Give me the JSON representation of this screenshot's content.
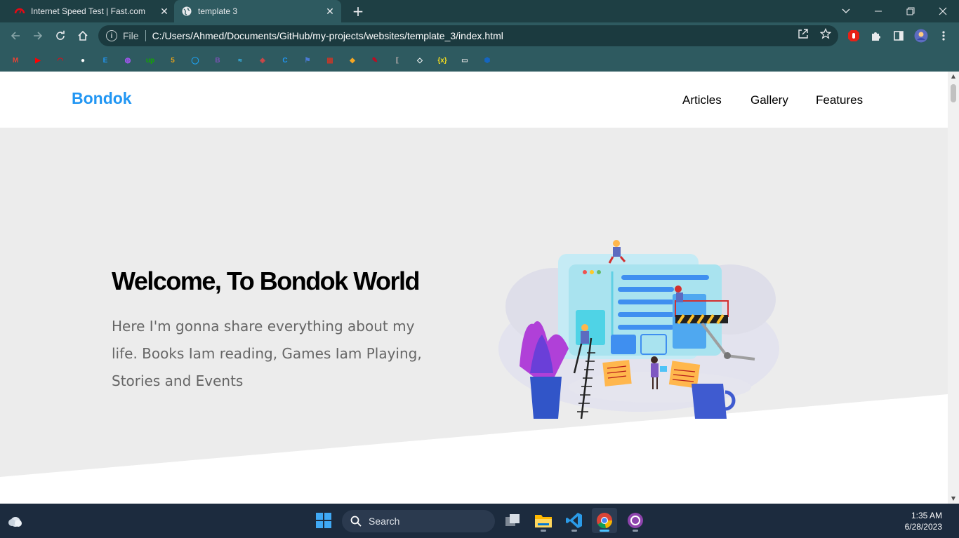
{
  "browser": {
    "tabs": [
      {
        "title": "Internet Speed Test | Fast.com",
        "active": false,
        "favicon": "fast-gauge-icon"
      },
      {
        "title": "template 3",
        "active": true,
        "favicon": "globe-icon"
      }
    ],
    "new_tab_label": "+",
    "address": {
      "scheme_label": "File",
      "url": "C:/Users/Ahmed/Documents/GitHub/my-projects/websites/template_3/index.html"
    },
    "bookmarks": [
      {
        "icon": "gmail-icon",
        "glyph": "M",
        "color": "#ea4335"
      },
      {
        "icon": "youtube-icon",
        "glyph": "▶",
        "color": "#ff0000"
      },
      {
        "icon": "fast-icon",
        "glyph": "◠",
        "color": "#e50914"
      },
      {
        "icon": "github-icon",
        "glyph": "●",
        "color": "#ffffff"
      },
      {
        "icon": "elzero-icon",
        "glyph": "E",
        "color": "#2196f3"
      },
      {
        "icon": "chat-icon",
        "glyph": "◍",
        "color": "#a855f7"
      },
      {
        "icon": "upwork-icon",
        "glyph": "up",
        "color": "#14a800"
      },
      {
        "icon": "html5-icon",
        "glyph": "5",
        "color": "#e4a11b"
      },
      {
        "icon": "circle-icon",
        "glyph": "◯",
        "color": "#1da1f2"
      },
      {
        "icon": "bootstrap-icon",
        "glyph": "B",
        "color": "#7952b3"
      },
      {
        "icon": "tailwind-icon",
        "glyph": "≈",
        "color": "#38bdf8"
      },
      {
        "icon": "gulp-icon",
        "glyph": "◈",
        "color": "#cf4647"
      },
      {
        "icon": "c-icon",
        "glyph": "C",
        "color": "#2196f3"
      },
      {
        "icon": "flag-icon",
        "glyph": "⚑",
        "color": "#4a7bd6"
      },
      {
        "icon": "grid-icon",
        "glyph": "▦",
        "color": "#c0392b"
      },
      {
        "icon": "diamond-icon",
        "glyph": "◆",
        "color": "#f5a623"
      },
      {
        "icon": "sketch-icon",
        "glyph": "✎",
        "color": "#d0021b"
      },
      {
        "icon": "brackets-icon",
        "glyph": "⟦",
        "color": "#9e9e9e"
      },
      {
        "icon": "codepen-icon",
        "glyph": "◇",
        "color": "#ffffff"
      },
      {
        "icon": "variable-icon",
        "glyph": "{x}",
        "color": "#f7df1e"
      },
      {
        "icon": "document-icon",
        "glyph": "▭",
        "color": "#e0e0e0"
      },
      {
        "icon": "shield-icon",
        "glyph": "⬢",
        "color": "#1565c0"
      }
    ]
  },
  "site": {
    "logo": "Bondok",
    "nav": [
      "Articles",
      "Gallery",
      "Features"
    ],
    "hero": {
      "title": "Welcome, To Bondok World",
      "text": "Here I'm gonna share everything about my life. Books Iam reading, Games Iam Playing, Stories and Events"
    },
    "colors": {
      "accent": "#2196f3",
      "hero_bg": "#ececec"
    }
  },
  "taskbar": {
    "search_label": "Search",
    "time": "1:35 AM",
    "date": "6/28/2023",
    "apps": [
      "task-view-icon",
      "file-explorer-icon",
      "vscode-icon",
      "chrome-icon",
      "github-desktop-icon"
    ]
  }
}
